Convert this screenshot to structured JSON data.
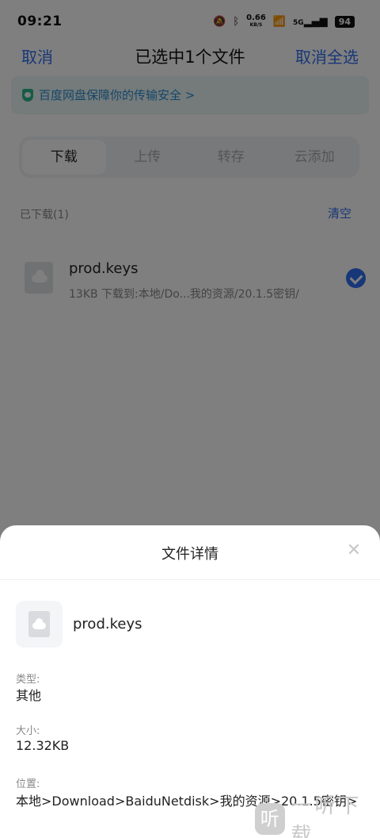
{
  "status_bar": {
    "time": "09:21",
    "net_speed": "0.66",
    "net_unit": "KB/S",
    "network": "5G",
    "battery": "94"
  },
  "title_bar": {
    "cancel_label": "取消",
    "title": "已选中1个文件",
    "deselect_all_label": "取消全选"
  },
  "security_banner": {
    "text": "百度网盘保障你的传输安全 >"
  },
  "tabs": [
    {
      "label": "下载",
      "active": true
    },
    {
      "label": "上传",
      "active": false
    },
    {
      "label": "转存",
      "active": false
    },
    {
      "label": "云添加",
      "active": false
    }
  ],
  "downloaded": {
    "section_label": "已下载(1)",
    "clear_label": "清空",
    "items": [
      {
        "name": "prod.keys",
        "meta": "13KB 下载到:本地/Do...我的资源/20.1.5密钥/",
        "checked": true
      }
    ]
  },
  "detail_sheet": {
    "title": "文件详情",
    "close_icon": "close-icon",
    "file_name": "prod.keys",
    "type_label": "类型:",
    "type_value": "其他",
    "size_label": "大小:",
    "size_value": "12.32KB",
    "location_label": "位置:",
    "location_value": "本地>Download>BaiduNetdisk>我的资源>20.1.5密钥>"
  },
  "watermark": {
    "text": "一听下载"
  },
  "colors": {
    "accent": "#2e6ef0",
    "banner_bg": "#e9f6f5",
    "banner_text": "#2d8dd2",
    "shield": "#2cb88a"
  }
}
